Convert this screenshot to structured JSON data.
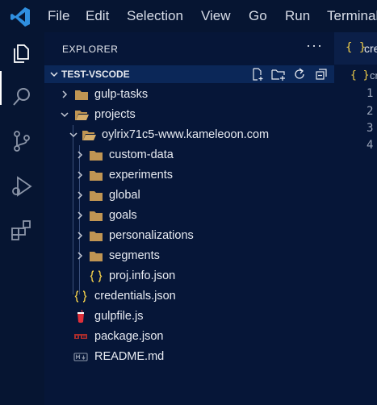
{
  "menu": {
    "items": [
      "File",
      "Edit",
      "Selection",
      "View",
      "Go",
      "Run",
      "Terminal"
    ]
  },
  "activity_bar": {
    "icons": [
      "explorer-icon",
      "search-icon",
      "source-control-icon",
      "run-debug-icon",
      "extensions-icon"
    ],
    "active": "explorer-icon"
  },
  "sidebar": {
    "title": "EXPLORER",
    "more_actions": "···",
    "section_title": "TEST-VSCODE",
    "header_actions": [
      "new-file-icon",
      "new-folder-icon",
      "refresh-icon",
      "collapse-all-icon"
    ]
  },
  "tree": [
    {
      "label": "gulp-tasks",
      "type": "folder",
      "expanded": false
    },
    {
      "label": "projects",
      "type": "folder",
      "expanded": true
    },
    {
      "label": "oylrix71c5-www.kameleoon.com",
      "type": "folder",
      "expanded": true
    },
    {
      "label": "custom-data",
      "type": "folder",
      "expanded": false
    },
    {
      "label": "experiments",
      "type": "folder",
      "expanded": false
    },
    {
      "label": "global",
      "type": "folder",
      "expanded": false
    },
    {
      "label": "goals",
      "type": "folder",
      "expanded": false
    },
    {
      "label": "personalizations",
      "type": "folder",
      "expanded": false
    },
    {
      "label": "segments",
      "type": "folder",
      "expanded": false
    },
    {
      "label": "proj.info.json",
      "type": "json"
    },
    {
      "label": "credentials.json",
      "type": "json"
    },
    {
      "label": "gulpfile.js",
      "type": "gulp"
    },
    {
      "label": "package.json",
      "type": "npm"
    },
    {
      "label": "README.md",
      "type": "markdown"
    }
  ],
  "editor": {
    "tab_icon": "{ }",
    "tab_label": "cre",
    "breadcrumb_icon": "{ }",
    "breadcrumb_label": "cr",
    "line_numbers": [
      "1",
      "2",
      "3",
      "4"
    ]
  },
  "colors": {
    "accent_blue": "#2f8fe0",
    "json_yellow": "#f2cf4a",
    "folder_brown": "#c09553",
    "section_header_bg": "#0b2758",
    "background": "#061638"
  }
}
